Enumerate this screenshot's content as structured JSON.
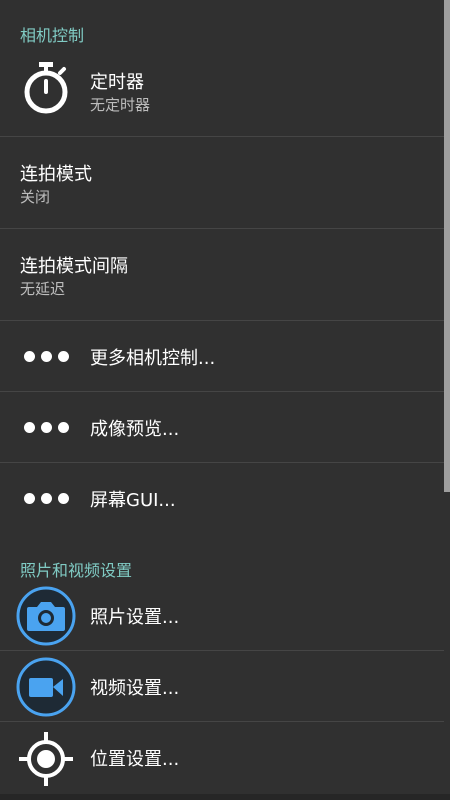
{
  "sections": {
    "camera_controls": "相机控制",
    "photo_video": "照片和视频设置"
  },
  "rows": {
    "timer": {
      "title": "定时器",
      "subtitle": "无定时器",
      "icon": "stopwatch-icon"
    },
    "burst_mode": {
      "title": "连拍模式",
      "subtitle": "关闭"
    },
    "burst_interval": {
      "title": "连拍模式间隔",
      "subtitle": "无延迟"
    },
    "more_camera_controls": {
      "title": "更多相机控制...",
      "icon": "more-dots-icon"
    },
    "image_preview": {
      "title": "成像预览...",
      "icon": "more-dots-icon"
    },
    "screen_gui": {
      "title": "屏幕GUI...",
      "icon": "more-dots-icon"
    },
    "photo_settings": {
      "title": "照片设置...",
      "icon": "camera-icon"
    },
    "video_settings": {
      "title": "视频设置...",
      "icon": "video-camera-icon"
    },
    "location_settings": {
      "title": "位置设置...",
      "icon": "location-target-icon"
    }
  },
  "colors": {
    "background": "#303030",
    "section_header": "#80cbc4",
    "accent_blue": "#4aa3f0",
    "divider": "#454545"
  }
}
